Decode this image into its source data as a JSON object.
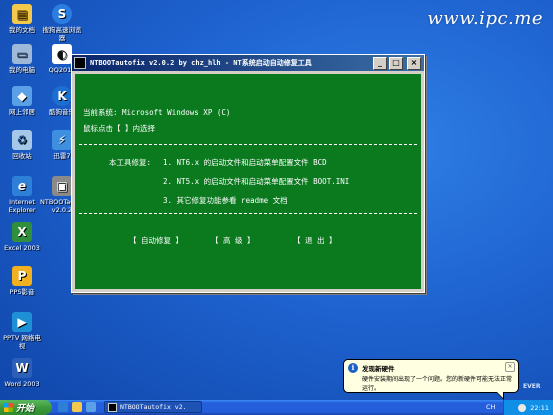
{
  "watermark": "www.ipc.me",
  "desktop": {
    "icons": [
      {
        "label": "我的文档",
        "color": "#f2c94c",
        "glyph": "▤"
      },
      {
        "label": "搜狗高速浏览器",
        "color": "#2a7de1",
        "glyph": "S"
      },
      {
        "label": "我的电脑",
        "color": "#9db8d9",
        "glyph": "▭"
      },
      {
        "label": "QQ2013",
        "color": "#ffffff",
        "glyph": "◐"
      },
      {
        "label": "网上邻居",
        "color": "#5aa0e6",
        "glyph": "◆"
      },
      {
        "label": "酷狗音乐",
        "color": "#1c6fd1",
        "glyph": "K"
      },
      {
        "label": "回收站",
        "color": "#a5c8e8",
        "glyph": "♻"
      },
      {
        "label": "迅雷7",
        "color": "#3f8fe0",
        "glyph": "⚡"
      },
      {
        "label": "Internet Explorer",
        "color": "#2e7fd8",
        "glyph": "e"
      },
      {
        "label": "NTBOOTautofix v2.0.2",
        "color": "#8a8a8a",
        "glyph": "▣"
      },
      {
        "label": "Excel 2003",
        "color": "#2f8f3a",
        "glyph": "X"
      },
      {
        "label": "PPS影音",
        "color": "#f0b020",
        "glyph": "P"
      },
      {
        "label": "PPTV 网络电视",
        "color": "#1e90d6",
        "glyph": "▶"
      },
      {
        "label": "Word 2003",
        "color": "#2b5fb8",
        "glyph": "W"
      }
    ]
  },
  "window": {
    "title": "NTBOOTautofix v2.0.2 by chz_hlh - NT系统启动自动修复工具",
    "minimize": "_",
    "maximize": "□",
    "close": "×",
    "console": {
      "current_system_label": "当前系统:",
      "current_system_value": "Microsoft Windows XP  (C)",
      "click_prompt": "鼠标点击【 】内选择",
      "tool_fix_label": "本工具修复:",
      "items": [
        "1. NT6.x 的启动文件和启动菜单配置文件 BCD",
        "2. NT5.x 的启动文件和启动菜单配置文件 BOOT.INI",
        "3. 其它修复功能参看 readme 文档"
      ],
      "buttons": {
        "auto_fix": "【 自动修复 】",
        "advanced": "【  高  级  】",
        "exit": "【  退  出  】"
      }
    }
  },
  "taskbar": {
    "start_label": "开始",
    "task_button": "NTBOOTautofix v2.",
    "lang": "CH",
    "clock": "22:11"
  },
  "balloon": {
    "title": "发现新硬件",
    "text": "硬件安装期间出现了一个问题。您的新硬件可能无法正常运行。",
    "close": "×"
  },
  "corner_text": "EVER"
}
